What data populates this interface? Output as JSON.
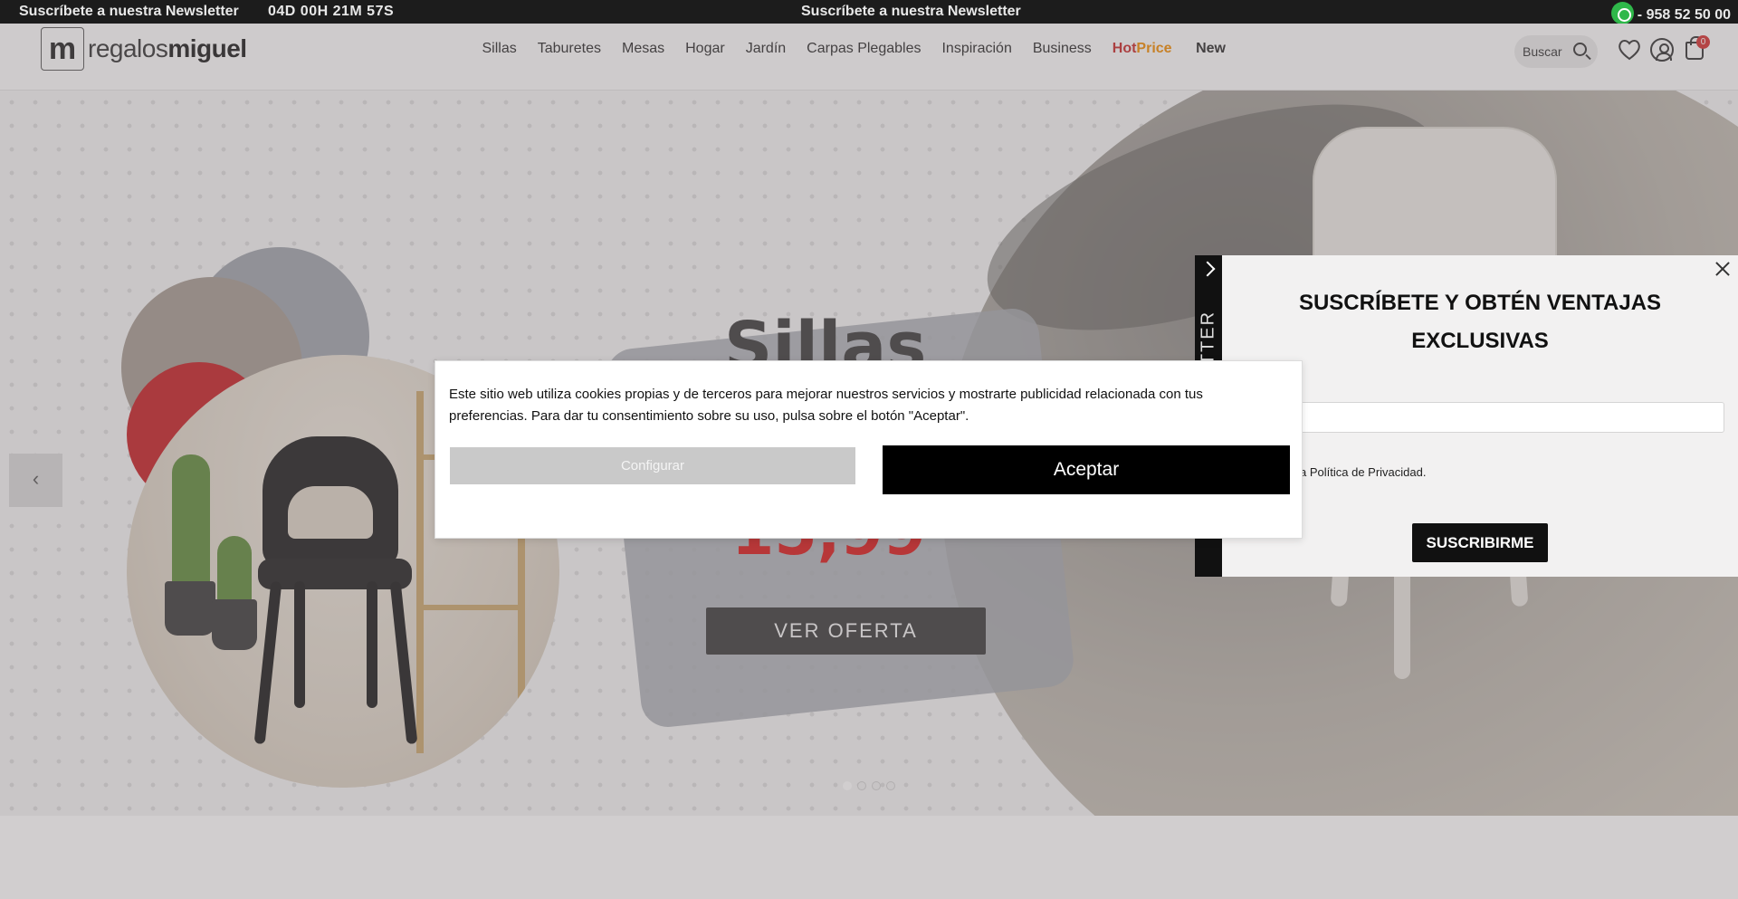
{
  "topbar": {
    "newsletter_left": "Suscríbete a nuestra Newsletter",
    "countdown": "04D 00H 21M 57S",
    "newsletter_center": "Suscríbete a nuestra Newsletter",
    "phone": "- 958 52 50 00",
    "whatsapp_icon": "whatsapp-icon"
  },
  "header": {
    "logo_mark": "m",
    "logo_text_light": "regalos",
    "logo_text_bold": "miguel",
    "nav": [
      "Sillas",
      "Taburetes",
      "Mesas",
      "Hogar",
      "Jardín",
      "Carpas Plegables",
      "Inspiración",
      "Business"
    ],
    "hot_part1": "Hot",
    "hot_part2": "Price",
    "new_label": "New",
    "search_placeholder": "Buscar",
    "cart_count": "0"
  },
  "hero": {
    "title": "Sillas",
    "price": "15,99",
    "cta": "VER OFERTA",
    "prev_arrow": "‹",
    "slides": 4,
    "active_slide": 1
  },
  "newsletter": {
    "tab_label": "ETTER",
    "title": "SUSCRÍBETE Y OBTÉN VENTAJAS EXCLUSIVAS",
    "email_placeholder": "email",
    "privacy": "a Política de Privacidad.",
    "submit": "SUSCRIBIRME"
  },
  "cookie": {
    "text": "Este sitio web utiliza cookies propias y de terceros para mejorar nuestros servicios y mostrarte publicidad relacionada con tus preferencias. Para dar tu consentimiento sobre su uso, pulsa sobre el botón \"Aceptar\".",
    "configure": "Configurar",
    "accept": "Aceptar"
  },
  "colors": {
    "accent_red": "#c62828",
    "accent_orange": "#f08a00",
    "badge": "#d32f2f",
    "topbar": "#1c1c1c"
  }
}
